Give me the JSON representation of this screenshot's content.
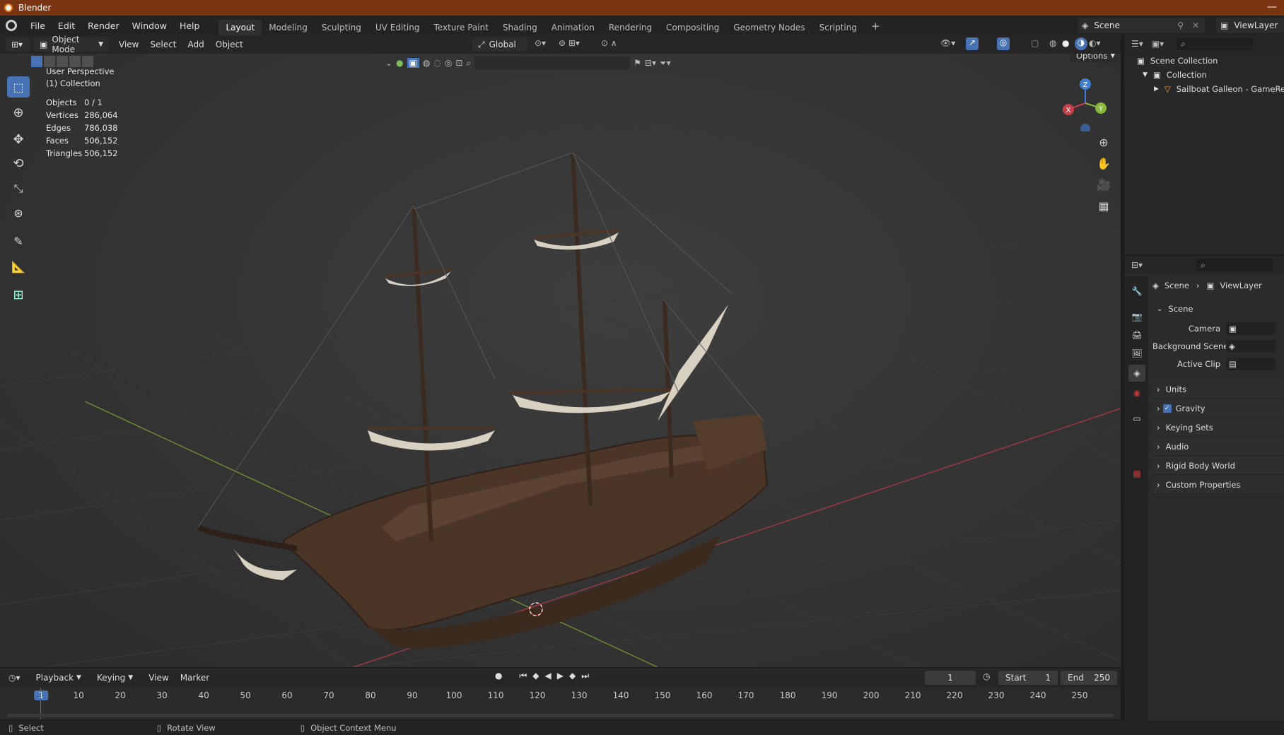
{
  "window": {
    "title": "Blender"
  },
  "menu": [
    "File",
    "Edit",
    "Render",
    "Window",
    "Help"
  ],
  "workspaces": [
    {
      "label": "Layout",
      "active": true
    },
    {
      "label": "Modeling"
    },
    {
      "label": "Sculpting"
    },
    {
      "label": "UV Editing"
    },
    {
      "label": "Texture Paint"
    },
    {
      "label": "Shading"
    },
    {
      "label": "Animation"
    },
    {
      "label": "Rendering"
    },
    {
      "label": "Compositing"
    },
    {
      "label": "Geometry Nodes"
    },
    {
      "label": "Scripting"
    }
  ],
  "add_workspace": "+",
  "scene_selector": {
    "scene": "Scene",
    "view_layer": "ViewLayer"
  },
  "viewport_header": {
    "mode": "Object Mode",
    "menus": [
      "View",
      "Select",
      "Add",
      "Object"
    ],
    "orientation": "Global",
    "options_label": "Options"
  },
  "viewport_overlay": {
    "perspective": "User Perspective",
    "collection": "(1) Collection",
    "stats": [
      {
        "label": "Objects",
        "value": "0 / 1"
      },
      {
        "label": "Vertices",
        "value": "286,064"
      },
      {
        "label": "Edges",
        "value": "786,038"
      },
      {
        "label": "Faces",
        "value": "506,152"
      },
      {
        "label": "Triangles",
        "value": "506,152"
      }
    ]
  },
  "gizmo": {
    "x": "X",
    "y": "Y",
    "z": "Z"
  },
  "outliner": {
    "root": "Scene Collection",
    "collection": "Collection",
    "object": "Sailboat Galleon - GameReady"
  },
  "properties": {
    "breadcrumb_scene": "Scene",
    "breadcrumb_layer": "ViewLayer",
    "panel_title": "Scene",
    "fields": [
      {
        "label": "Camera"
      },
      {
        "label": "Background Scene"
      },
      {
        "label": "Active Clip"
      }
    ],
    "sections": [
      {
        "label": "Units"
      },
      {
        "label": "Gravity",
        "checked": true
      },
      {
        "label": "Keying Sets"
      },
      {
        "label": "Audio"
      },
      {
        "label": "Rigid Body World"
      },
      {
        "label": "Custom Properties"
      }
    ]
  },
  "timeline": {
    "menus": [
      "Playback",
      "Keying",
      "View",
      "Marker"
    ],
    "current_frame": "1",
    "start_label": "Start",
    "start_value": "1",
    "end_label": "End",
    "end_value": "250",
    "ticks": [
      "1",
      "10",
      "20",
      "30",
      "40",
      "50",
      "60",
      "70",
      "80",
      "90",
      "100",
      "110",
      "120",
      "130",
      "140",
      "150",
      "160",
      "170",
      "180",
      "190",
      "200",
      "210",
      "220",
      "230",
      "240",
      "250"
    ]
  },
  "statusbar": {
    "select": "Select",
    "rotate": "Rotate View",
    "context": "Object Context Menu"
  },
  "colors": {
    "accent": "#4772b3",
    "titlebar": "#7b3411",
    "x_axis": "#c8404c",
    "y_axis": "#86b83a",
    "z_axis": "#3f7fd1"
  }
}
